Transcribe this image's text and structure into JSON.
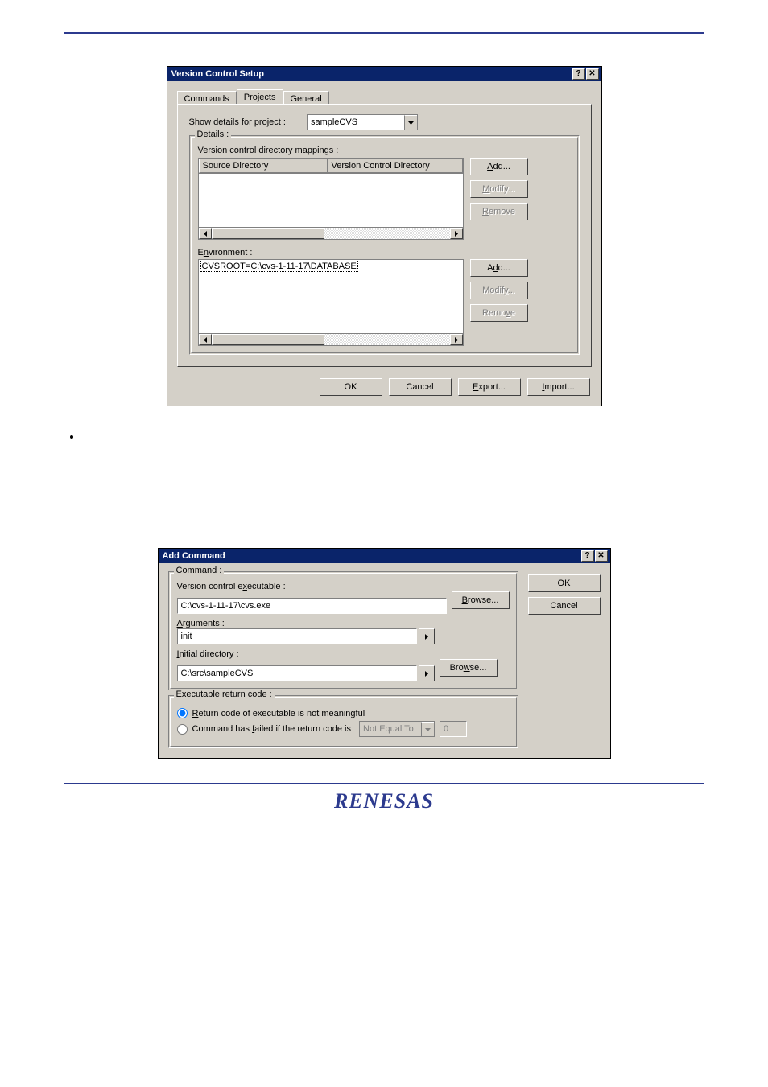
{
  "dialog1": {
    "title": "Version Control Setup",
    "tabs": {
      "commands": "Commands",
      "projects": "Projects",
      "general": "General"
    },
    "show_details_label": "Show details for project :",
    "project_value": "sampleCVS",
    "details_label": "Details :",
    "mappings_label": "Version control directory mappings :",
    "col_source": "Source Directory",
    "col_vcdir": "Version Control Directory",
    "add1": "Add...",
    "modify1": "Modify...",
    "remove1": "Remove",
    "env_label": "Environment :",
    "env_value": "CVSROOT=C:\\cvs-1-11-17\\DATABASE",
    "add2": "Add...",
    "modify2": "Modify...",
    "remove2": "Remove",
    "ok": "OK",
    "cancel": "Cancel",
    "export": "Export...",
    "import": "Import..."
  },
  "dialog2": {
    "title": "Add Command",
    "command_group": "Command :",
    "vce_label": "Version control executable :",
    "vce_value": "C:\\cvs-1-11-17\\cvs.exe",
    "browse1": "Browse...",
    "args_label": "Arguments :",
    "args_value": "init",
    "initdir_label": "Initial directory :",
    "initdir_value": "C:\\src\\sampleCVS",
    "browse2": "Browse...",
    "erc_group": "Executable return code :",
    "radio_not_meaningful": "Return code of executable is not meaningful",
    "radio_failed_prefix": "Command has failed if the return code is",
    "compare_value": "Not Equal To",
    "code_value": "0",
    "ok": "OK",
    "cancel": "Cancel"
  }
}
